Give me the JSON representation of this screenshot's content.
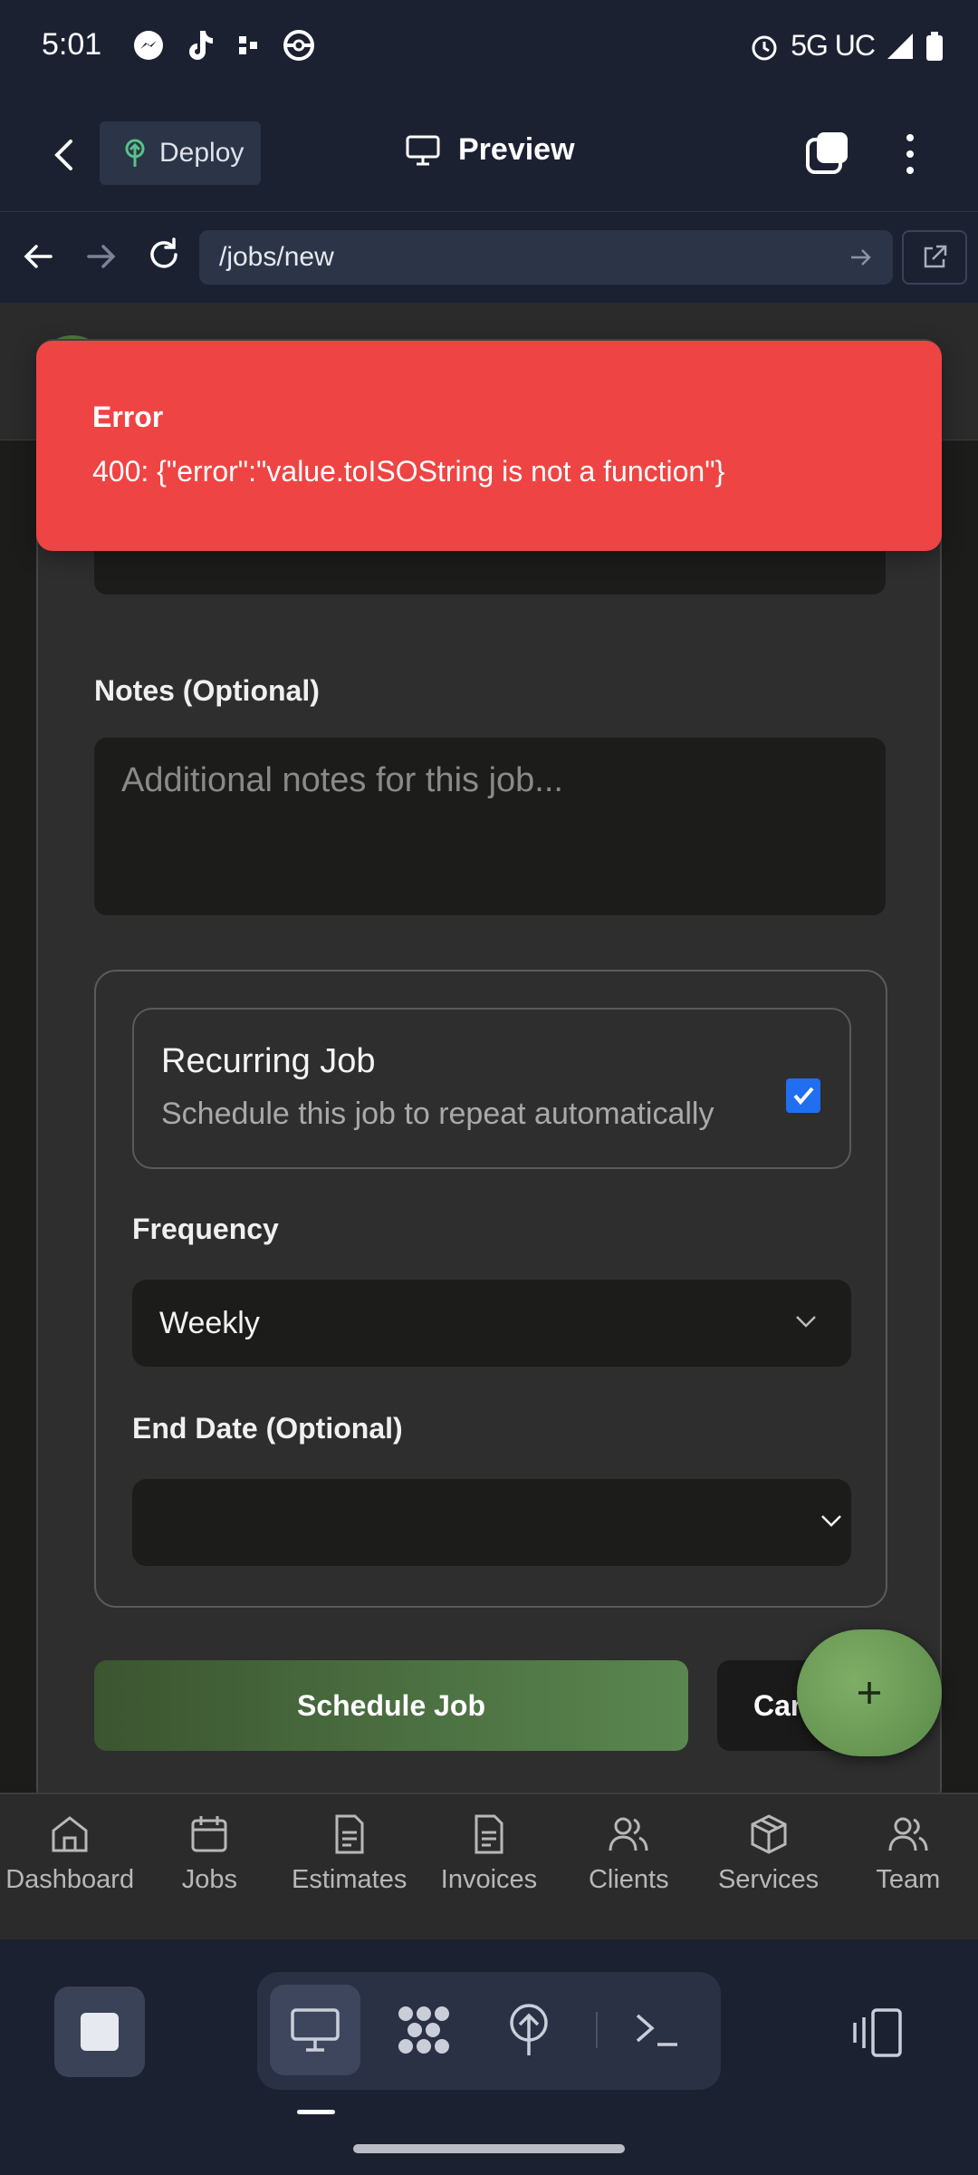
{
  "status_bar": {
    "time": "5:01",
    "network": "5G UC"
  },
  "header": {
    "deploy_label": "Deploy",
    "preview_label": "Preview"
  },
  "browser": {
    "url": "/jobs/new"
  },
  "form": {
    "notes_label": "Notes (Optional)",
    "notes_placeholder": "Additional notes for this job...",
    "recurring_title": "Recurring Job",
    "recurring_subtitle": "Schedule this job to repeat automatically",
    "recurring_checked": true,
    "frequency_label": "Frequency",
    "frequency_value": "Weekly",
    "end_date_label": "End Date (Optional)",
    "end_date_value": "",
    "schedule_button": "Schedule Job",
    "cancel_button": "Cancel"
  },
  "toast": {
    "title": "Error",
    "message": "400: {\"error\":\"value.toISOString is not a function\"}"
  },
  "bottom_nav": {
    "items": [
      {
        "label": "Dashboard",
        "icon": "home-icon"
      },
      {
        "label": "Jobs",
        "icon": "calendar-icon"
      },
      {
        "label": "Estimates",
        "icon": "document-icon"
      },
      {
        "label": "Invoices",
        "icon": "document-icon"
      },
      {
        "label": "Clients",
        "icon": "users-icon"
      },
      {
        "label": "Services",
        "icon": "package-icon"
      },
      {
        "label": "Team",
        "icon": "users-icon"
      }
    ]
  },
  "colors": {
    "toast_bg": "#ef4444",
    "primary_green": "#5a8650",
    "checkbox_blue": "#1f6ff0",
    "app_bg": "#1c2132"
  }
}
